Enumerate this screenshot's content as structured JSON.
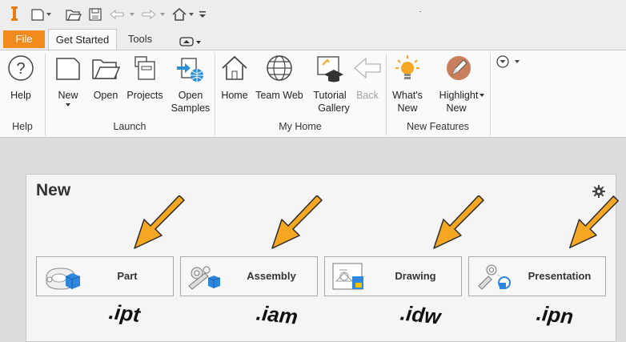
{
  "quick_access": {
    "logo": "inventor-logo",
    "icons": [
      "new-icon",
      "open-icon",
      "save-icon",
      "undo-icon",
      "redo-icon",
      "home-icon",
      "customize-icon"
    ]
  },
  "tabs": [
    {
      "label": "File"
    },
    {
      "label": "Get Started"
    },
    {
      "label": "Tools"
    }
  ],
  "ribbon": {
    "buttons": {
      "help": {
        "line1": "Help",
        "line2": ""
      },
      "new": {
        "line1": "New",
        "line2": ""
      },
      "open": {
        "line1": "Open",
        "line2": ""
      },
      "projects": {
        "line1": "Projects",
        "line2": ""
      },
      "open_samples": {
        "line1": "Open",
        "line2": "Samples"
      },
      "home": {
        "line1": "Home",
        "line2": ""
      },
      "team_web": {
        "line1": "Team Web",
        "line2": ""
      },
      "tutorial": {
        "line1": "Tutorial",
        "line2": "Gallery"
      },
      "back": {
        "line1": "Back",
        "line2": ""
      },
      "whats_new": {
        "line1": "What's",
        "line2": "New"
      },
      "highlight": {
        "line1": "Highlight",
        "line2": "New"
      }
    },
    "groups": {
      "help": "Help",
      "launch": "Launch",
      "my_home": "My Home",
      "new_features": "New Features"
    }
  },
  "new_panel": {
    "title": "New",
    "buttons": [
      {
        "label": "Part",
        "ext": ".ipt"
      },
      {
        "label": "Assembly",
        "ext": ".iam"
      },
      {
        "label": "Drawing",
        "ext": ".idw"
      },
      {
        "label": "Presentation",
        "ext": ".ipn"
      }
    ]
  },
  "colors": {
    "accent": "#f28b1e",
    "arrow": "#f5a623",
    "arrow_outline": "#2b2b2b"
  }
}
